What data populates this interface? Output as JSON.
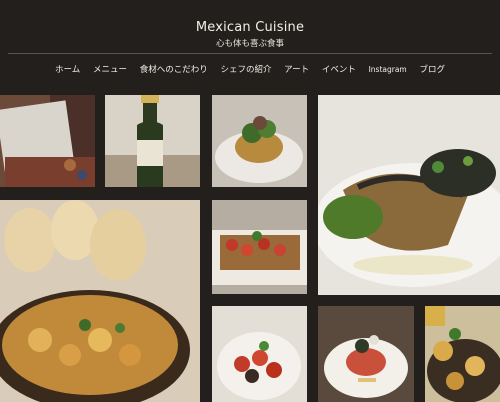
{
  "header": {
    "title": "Mexican Cuisine",
    "subtitle": "心も体も喜ぶ食事"
  },
  "nav": {
    "items": [
      "ホーム",
      "メニュー",
      "食材へのこだわり",
      "シェフの紹介",
      "アート",
      "イベント",
      "Instagram",
      "ブログ"
    ]
  },
  "gallery": {
    "photos": [
      "gift-box-photo",
      "champagne-bottle-photo",
      "fried-plate-with-greens-photo",
      "fish-fillet-with-pesto-photo",
      "shrimp-cazuela-with-bread-photo",
      "tomato-tostada-photo",
      "tomato-salsa-plate-photo",
      "garnished-stack-plate-photo",
      "seafood-pasta-photo"
    ]
  }
}
